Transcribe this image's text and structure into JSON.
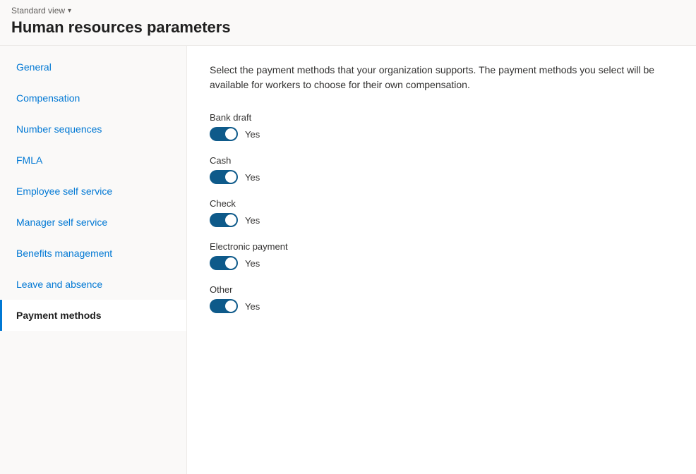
{
  "topbar": {
    "view_label": "Standard view",
    "chevron": "▾"
  },
  "page": {
    "title": "Human resources parameters"
  },
  "sidebar": {
    "items": [
      {
        "id": "general",
        "label": "General",
        "active": false
      },
      {
        "id": "compensation",
        "label": "Compensation",
        "active": false
      },
      {
        "id": "number-sequences",
        "label": "Number sequences",
        "active": false
      },
      {
        "id": "fmla",
        "label": "FMLA",
        "active": false
      },
      {
        "id": "employee-self-service",
        "label": "Employee self service",
        "active": false
      },
      {
        "id": "manager-self-service",
        "label": "Manager self service",
        "active": false
      },
      {
        "id": "benefits-management",
        "label": "Benefits management",
        "active": false
      },
      {
        "id": "leave-and-absence",
        "label": "Leave and absence",
        "active": false
      },
      {
        "id": "payment-methods",
        "label": "Payment methods",
        "active": true
      }
    ]
  },
  "main": {
    "description": "Select the payment methods that your organization supports. The payment methods you select will be available for workers to choose for their own compensation.",
    "payment_items": [
      {
        "id": "bank-draft",
        "label": "Bank draft",
        "enabled": true,
        "yes_label": "Yes"
      },
      {
        "id": "cash",
        "label": "Cash",
        "enabled": true,
        "yes_label": "Yes"
      },
      {
        "id": "check",
        "label": "Check",
        "enabled": true,
        "yes_label": "Yes"
      },
      {
        "id": "electronic-payment",
        "label": "Electronic payment",
        "enabled": true,
        "yes_label": "Yes"
      },
      {
        "id": "other",
        "label": "Other",
        "enabled": true,
        "yes_label": "Yes"
      }
    ]
  }
}
